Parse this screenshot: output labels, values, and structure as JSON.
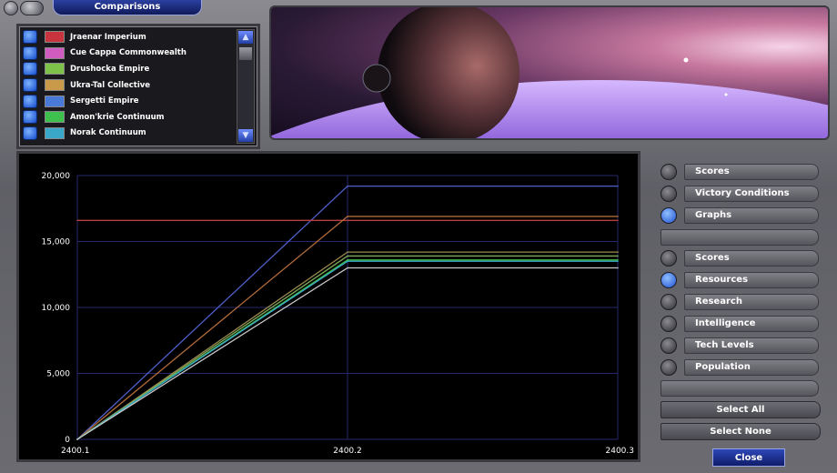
{
  "window": {
    "title": "Comparisons"
  },
  "empires": [
    {
      "name": "Jraenar Imperium",
      "icon": "empire-emblem-jraenar",
      "icon_color": "#c8343e"
    },
    {
      "name": "Cue Cappa Commonwealth",
      "icon": "empire-emblem-cue-cappa",
      "icon_color": "#d05cc0"
    },
    {
      "name": "Drushocka Empire",
      "icon": "empire-emblem-drushocka",
      "icon_color": "#7ec24a"
    },
    {
      "name": "Ukra-Tal Collective",
      "icon": "empire-emblem-ukra-tal",
      "icon_color": "#c89a4a"
    },
    {
      "name": "Sergetti Empire",
      "icon": "empire-emblem-sergetti",
      "icon_color": "#4a7ad8"
    },
    {
      "name": "Amon'krie Continuum",
      "icon": "empire-emblem-amonkrie",
      "icon_color": "#3ec04e"
    },
    {
      "name": "Norak Continuum",
      "icon": "empire-emblem-norak",
      "icon_color": "#3aa6c8"
    }
  ],
  "categories": [
    {
      "label": "Scores",
      "selected": false
    },
    {
      "label": "Victory Conditions",
      "selected": false
    },
    {
      "label": "Graphs",
      "selected": true
    }
  ],
  "graph_types": [
    {
      "label": "Scores",
      "selected": false
    },
    {
      "label": "Resources",
      "selected": true
    },
    {
      "label": "Research",
      "selected": false
    },
    {
      "label": "Intelligence",
      "selected": false
    },
    {
      "label": "Tech Levels",
      "selected": false
    },
    {
      "label": "Population",
      "selected": false
    }
  ],
  "buttons": {
    "select_all": "Select All",
    "select_none": "Select None",
    "close": "Close"
  },
  "colors": {
    "accent": "#1f3fb0",
    "grid": "#27276e",
    "axis_text": "#ffffff"
  },
  "chart_data": {
    "type": "line",
    "x": [
      "2400.1",
      "2400.2",
      "2400.3"
    ],
    "ylim": [
      0,
      20000
    ],
    "yticks": [
      0,
      5000,
      10000,
      15000,
      20000
    ],
    "ytick_labels": [
      "0",
      "5,000",
      "10,000",
      "15,000",
      "20,000"
    ],
    "grid": true,
    "series": [
      {
        "color": "#4f5fc8",
        "values": [
          0,
          19200,
          19200
        ]
      },
      {
        "color": "#b84040",
        "values": [
          16600,
          16600,
          16600
        ]
      },
      {
        "color": "#b06a3a",
        "values": [
          0,
          16900,
          16900
        ]
      },
      {
        "color": "#9a8a50",
        "values": [
          0,
          14200,
          14200
        ]
      },
      {
        "color": "#7eaa5a",
        "values": [
          0,
          13900,
          13900
        ]
      },
      {
        "color": "#3ec04e",
        "values": [
          0,
          13600,
          13600
        ]
      },
      {
        "color": "#3aa6c8",
        "values": [
          0,
          13500,
          13500
        ]
      },
      {
        "color": "#c8c8c8",
        "values": [
          0,
          13000,
          13000
        ]
      }
    ]
  }
}
